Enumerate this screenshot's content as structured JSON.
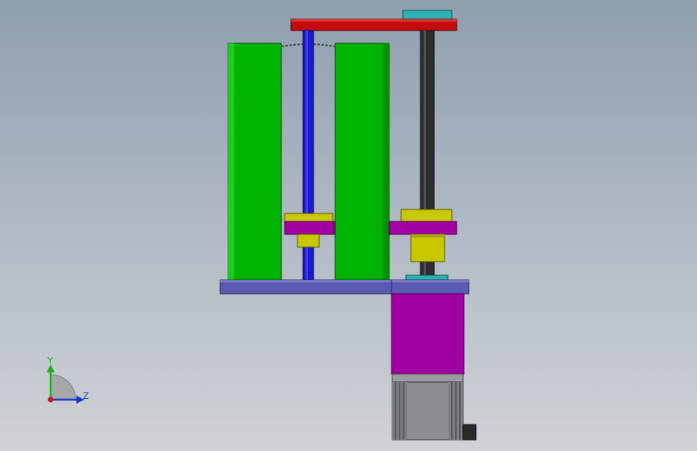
{
  "view": {
    "mode": "cad-3d-viewport",
    "background_top_color": "#8f9fb0",
    "background_bottom_color": "#cfd2d6"
  },
  "model": {
    "part_colors": {
      "guide_columns": "#00b300",
      "top_plate": "#c40a0a",
      "lead_screw": "#1a1acc",
      "threaded_rod": "#2d2d2d",
      "carriage_plates": "#a300a3",
      "bearings": "#c8c800",
      "couplers": "#2ab3b3",
      "base_plate": "#5a5ab0",
      "motor_housing": "#a300a3",
      "stepper_motor": "#8a8d92"
    }
  },
  "triad": {
    "y_label": "Y",
    "z_label": "Z",
    "y_color": "#16b516",
    "z_color": "#1a3acc",
    "origin_color": "#cc1a1a"
  }
}
